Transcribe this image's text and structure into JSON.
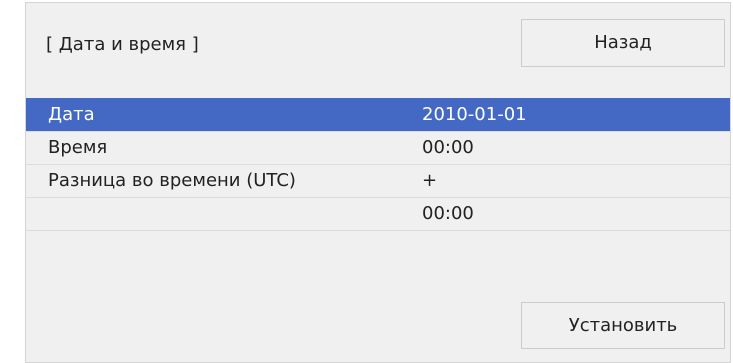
{
  "header": {
    "title": "[ Дата и время ]",
    "back_label": "Назад"
  },
  "rows": [
    {
      "label": "Дата",
      "value": "2010-01-01",
      "selected": true
    },
    {
      "label": "Время",
      "value": "00:00",
      "selected": false
    },
    {
      "label": "Разница во времени (UTC)",
      "value": "+",
      "selected": false
    },
    {
      "label": "",
      "value": "00:00",
      "selected": false
    }
  ],
  "footer": {
    "set_label": "Установить"
  },
  "colors": {
    "panel_bg": "#f0f0f0",
    "selection": "#4369c4",
    "selected_text": "#ffffff",
    "text": "#222222"
  }
}
